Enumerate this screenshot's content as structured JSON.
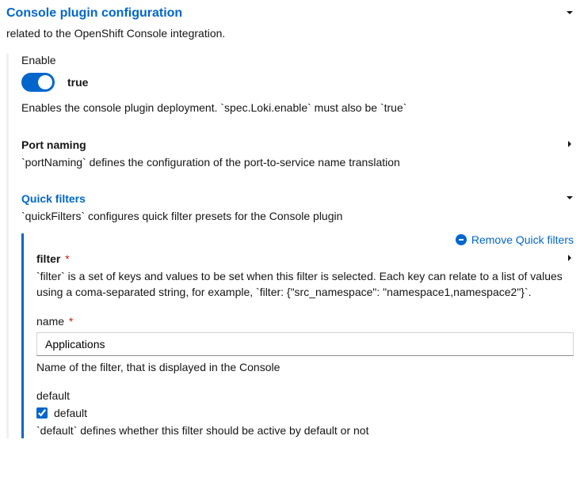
{
  "header": {
    "title": "Console plugin configuration",
    "desc": "related to the OpenShift Console integration."
  },
  "enable": {
    "label": "Enable",
    "value_label": "true",
    "helper": "Enables the console plugin deployment. `spec.Loki.enable` must also be `true`"
  },
  "portNaming": {
    "title": "Port naming",
    "desc": "`portNaming` defines the configuration of the port-to-service name translation"
  },
  "quickFilters": {
    "title": "Quick filters",
    "desc": "`quickFilters` configures quick filter presets for the Console plugin",
    "remove_label": "Remove Quick filters",
    "filter": {
      "title": "filter",
      "desc": "`filter` is a set of keys and values to be set when this filter is selected. Each key can relate to a list of values using a coma-separated string, for example, `filter: {\"src_namespace\": \"namespace1,namespace2\"}`."
    },
    "name": {
      "label": "name",
      "value": "Applications",
      "helper": "Name of the filter, that is displayed in the Console"
    },
    "default": {
      "group_label": "default",
      "checkbox_label": "default",
      "helper": "`default` defines whether this filter should be active by default or not"
    }
  }
}
